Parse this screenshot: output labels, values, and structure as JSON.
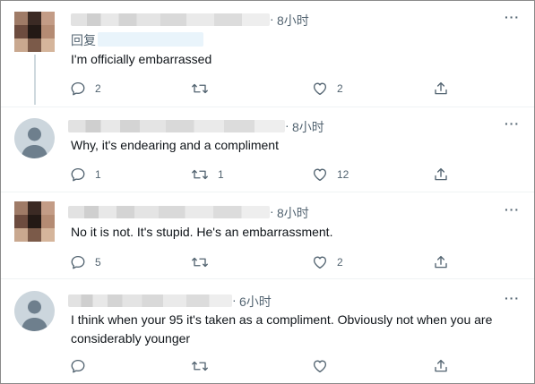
{
  "tweets": [
    {
      "time": "8小时",
      "reply_to_label": "回复",
      "text": "I'm officially embarrassed",
      "replies": "2",
      "retweets": "",
      "likes": "2"
    },
    {
      "time": "8小时",
      "text": "Why, it's endearing and a compliment",
      "replies": "1",
      "retweets": "1",
      "likes": "12"
    },
    {
      "time": "8小时",
      "text": "No it is not. It's stupid. He's an embarrassment.",
      "replies": "5",
      "retweets": "",
      "likes": "2"
    },
    {
      "time": "6小时",
      "text": "I think when your 95 it's taken as a compliment. Obviously not when you are considerably younger",
      "replies": "",
      "retweets": "",
      "likes": ""
    }
  ],
  "separator_dot": "·",
  "more_glyph": "···",
  "icons": [
    "reply-icon",
    "retweet-icon",
    "like-icon",
    "share-icon",
    "more-icon",
    "default-avatar-icon"
  ],
  "colors": {
    "secondary_text": "#536471",
    "thread_line": "#cfd9de",
    "reply_highlight": "#e9f4fb"
  }
}
